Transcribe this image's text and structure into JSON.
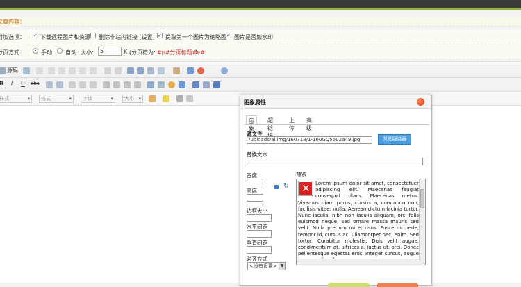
{
  "section": {
    "title": "文章内容："
  },
  "options_row": {
    "label": "附加选项：",
    "checkboxes": [
      {
        "label": "下载远程图片和资源",
        "checked": true
      },
      {
        "label": "删除非站内链接 [设置]",
        "checked": false
      },
      {
        "label": "提取第一个图片为缩略图",
        "checked": true
      },
      {
        "label": "图片是否加水印",
        "checked": true
      }
    ]
  },
  "paging_row": {
    "label": "分页方式：",
    "manual": "手动",
    "auto": "自动",
    "size_label": "大小:",
    "size_value": "5",
    "unit": "K",
    "note_prefix": "(分页符为:",
    "note_code": "#p#分页标题#e#",
    "note_suffix": ")"
  },
  "toolbar": {
    "source_label": "源码",
    "bold": "B",
    "italic": "I",
    "underline": "U",
    "strike": "abc",
    "combos": [
      "样式",
      "格式",
      "字体",
      "大小"
    ]
  },
  "dialog": {
    "title": "图象属性",
    "tabs": [
      "图象",
      "超链接",
      "上传",
      "高级"
    ],
    "active_tab": 0,
    "source_label": "源文件",
    "source_value": "/uploads/allimg/160718/1-160GQ5502a49.jpg",
    "browse_label": "浏览服务器",
    "alt_label": "替换文本",
    "alt_value": "",
    "width_label": "宽度",
    "height_label": "高度",
    "border_label": "边框大小",
    "hspace_label": "水平间距",
    "vspace_label": "垂直间距",
    "align_label": "对齐方式",
    "align_value": "<没有设置>",
    "preview_label": "预览",
    "preview_text": "Lorem ipsum dolor sit amet, consectetuer adipiscing elit. Maecenas feugiat consequat diam. Maecenas metus. Vivamus diam purus, cursus a, commodo non, facilisis vitae, nulla. Aenean dictum lacinia tortor. Nunc iaculis, nibh non iaculis aliquam, orci felis euismod neque, sed ornare massa mauris sed velit. Nulla pretium mi et risus. Fusce mi pede, tempor id, cursus ac, ullamcorper nec, enim. Sed tortor. Curabitur molestie. Duis velit augue, condimentum at, ultrices a, luctus ut, orci. Donec pellentesque egestas eros. Integer cursus, augue in cursus faucibus"
  },
  "colors": {
    "accent": "#8ab13d",
    "section_text": "#c06a00",
    "browse_button": "#4a9ee0",
    "paging_note": "#d03030"
  }
}
